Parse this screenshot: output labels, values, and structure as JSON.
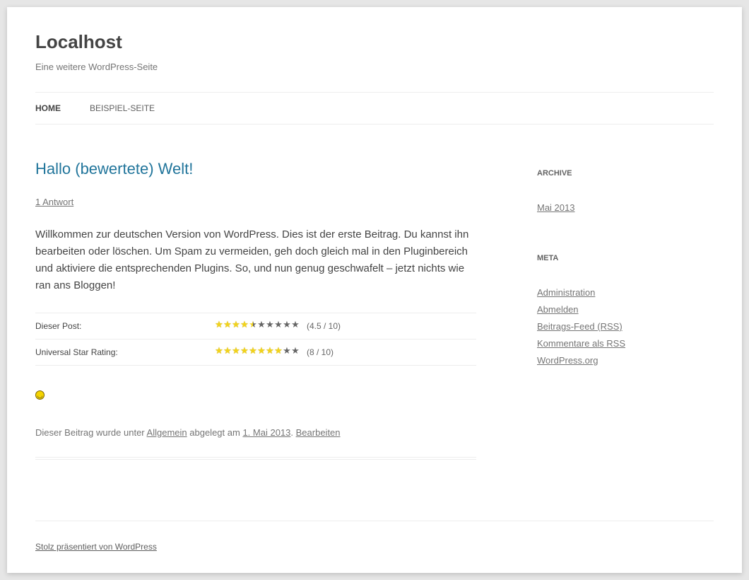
{
  "site": {
    "title": "Localhost",
    "description": "Eine weitere WordPress-Seite"
  },
  "nav": {
    "items": [
      {
        "label": "Home",
        "current": true
      },
      {
        "label": "Beispiel-Seite",
        "current": false
      }
    ]
  },
  "post": {
    "title": "Hallo (bewertete) Welt!",
    "comments_link": "1 Antwort",
    "body": "Willkommen zur deutschen Version von WordPress. Dies ist der erste Beitrag. Du kannst ihn bearbeiten oder löschen. Um Spam zu vermeiden, geh doch gleich mal in den Pluginbereich und aktiviere die entsprechenden Plugins. So, und nun genug geschwafelt – jetzt nichts wie ran ans Bloggen!",
    "ratings": [
      {
        "label": "Dieser Post:",
        "rating": 4.5,
        "max": 10,
        "text": "(4.5 / 10)"
      },
      {
        "label": "Universal Star Rating:",
        "rating": 8,
        "max": 10,
        "text": "(8 / 10)"
      }
    ],
    "smiley_icon": "smiley-icon",
    "meta": {
      "prefix": "Dieser Beitrag wurde unter",
      "category": "Allgemein",
      "middle": "abgelegt am",
      "date": "1. Mai 2013",
      "dot": ".",
      "edit": "Bearbeiten"
    }
  },
  "sidebar": {
    "archive": {
      "title": "Archive",
      "items": [
        "Mai 2013"
      ]
    },
    "meta": {
      "title": "Meta",
      "items": [
        "Administration",
        "Abmelden",
        "Beitrags-Feed (RSS)",
        "Kommentare als RSS",
        "WordPress.org"
      ]
    }
  },
  "footer": {
    "credit": "Stolz präsentiert von WordPress"
  },
  "colors": {
    "link": "#21759b",
    "star_on": "#f2d31b",
    "star_off": "#666666",
    "background": "#e6e6e6"
  }
}
